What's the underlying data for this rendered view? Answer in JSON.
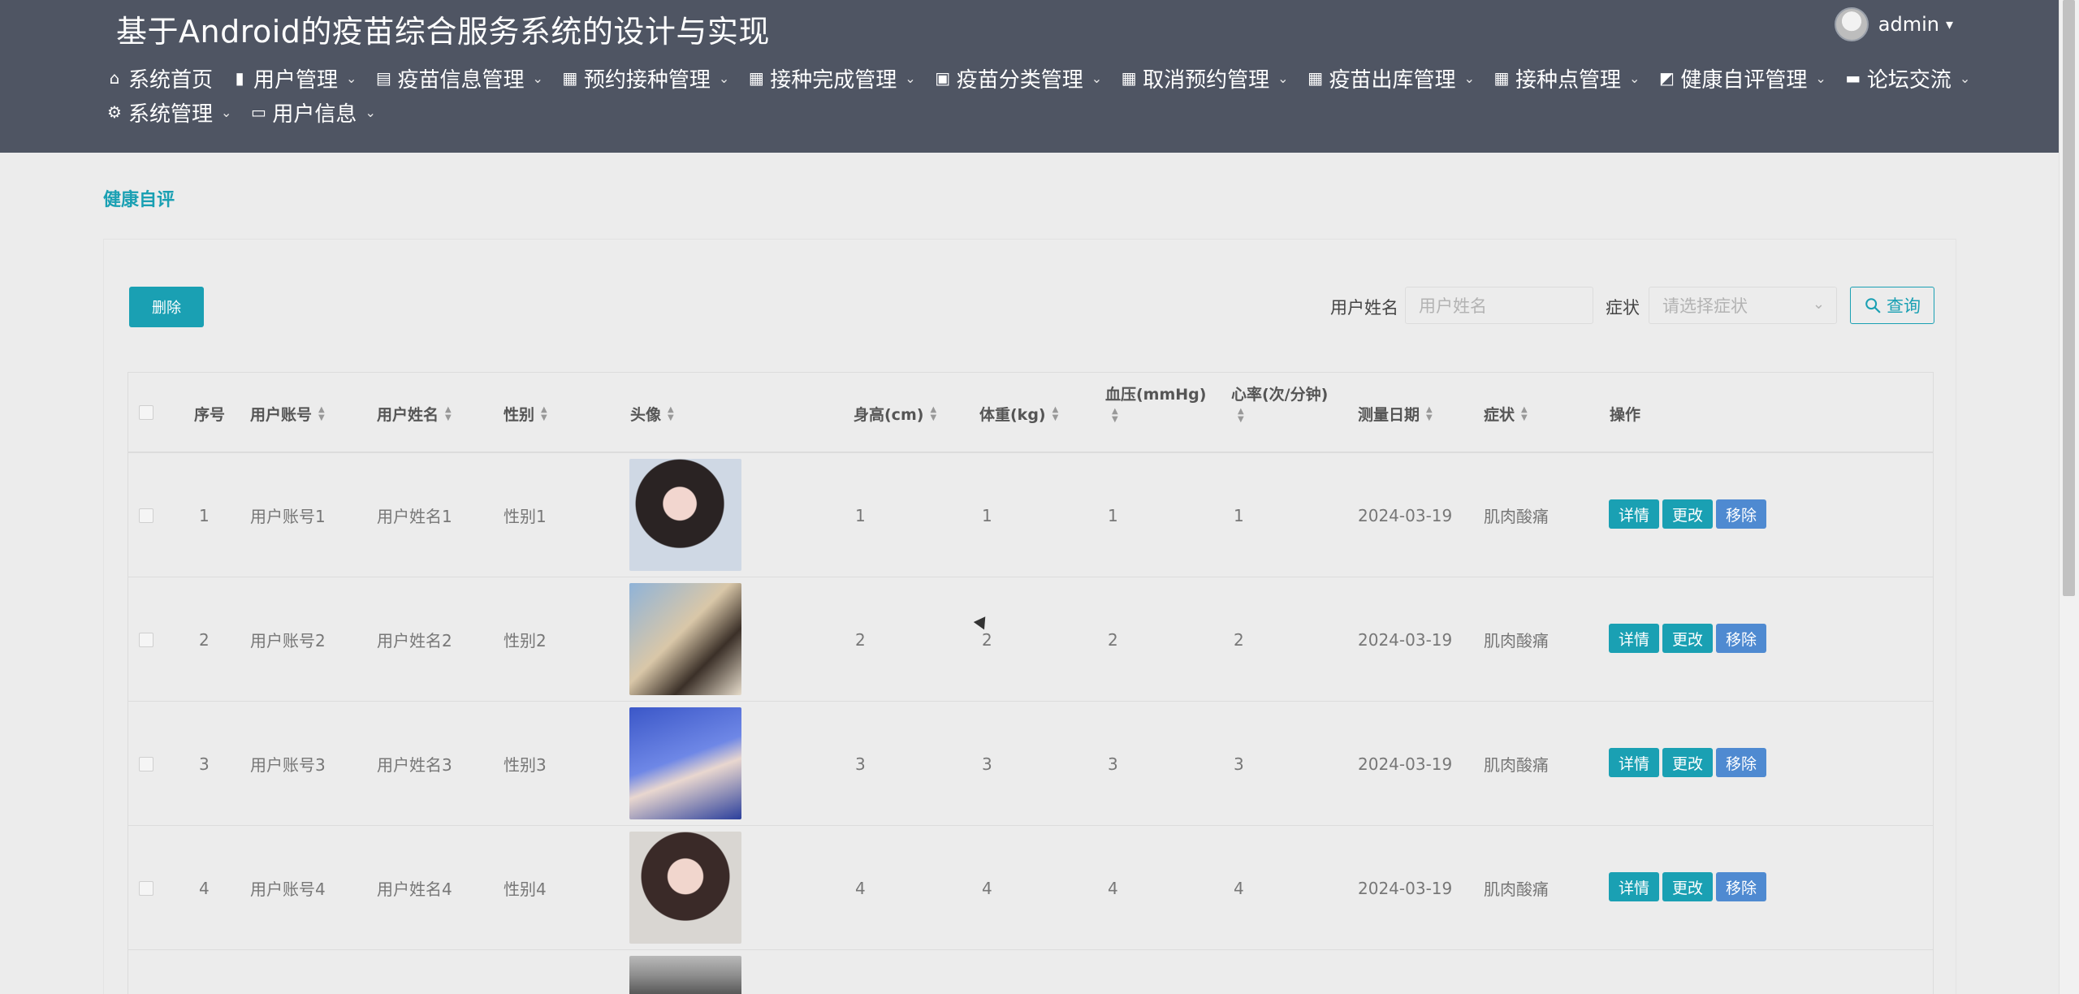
{
  "app": {
    "title": "基于Android的疫苗综合服务系统的设计与实现"
  },
  "user": {
    "name": "admin",
    "avatar_icon": "user-avatar-icon"
  },
  "nav": [
    {
      "label": "系统首页",
      "icon": "home-icon",
      "dropdown": false
    },
    {
      "label": "用户管理",
      "icon": "bar-chart-icon",
      "dropdown": true
    },
    {
      "label": "疫苗信息管理",
      "icon": "clipboard-icon",
      "dropdown": true
    },
    {
      "label": "预约接种管理",
      "icon": "grid-icon",
      "dropdown": true
    },
    {
      "label": "接种完成管理",
      "icon": "grid-icon",
      "dropdown": true
    },
    {
      "label": "疫苗分类管理",
      "icon": "clipboard-check-icon",
      "dropdown": true
    },
    {
      "label": "取消预约管理",
      "icon": "grid-icon",
      "dropdown": true
    },
    {
      "label": "疫苗出库管理",
      "icon": "grid-icon",
      "dropdown": true
    },
    {
      "label": "接种点管理",
      "icon": "grid-icon",
      "dropdown": true
    },
    {
      "label": "健康自评管理",
      "icon": "line-chart-icon",
      "dropdown": true
    },
    {
      "label": "论坛交流",
      "icon": "forum-icon",
      "dropdown": true
    },
    {
      "label": "系统管理",
      "icon": "settings-icon",
      "dropdown": true
    },
    {
      "label": "用户信息",
      "icon": "id-card-icon",
      "dropdown": true
    }
  ],
  "breadcrumb": "健康自评",
  "toolbar": {
    "delete_label": "删除"
  },
  "search": {
    "name_label": "用户姓名",
    "name_placeholder": "用户姓名",
    "symptom_label": "症状",
    "symptom_placeholder": "请选择症状",
    "query_label": "查询"
  },
  "table": {
    "headers": {
      "index": "序号",
      "account": "用户账号",
      "name": "用户姓名",
      "gender": "性别",
      "avatar": "头像",
      "height": "身高(cm)",
      "weight": "体重(kg)",
      "bp": "血压(mmHg)",
      "hr": "心率(次/分钟)",
      "date": "测量日期",
      "symptom": "症状",
      "ops": "操作"
    },
    "rows": [
      {
        "index": "1",
        "account": "用户账号1",
        "name": "用户姓名1",
        "gender": "性别1",
        "height": "1",
        "weight": "1",
        "bp": "1",
        "hr": "1",
        "date": "2024-03-19",
        "symptom": "肌肉酸痛"
      },
      {
        "index": "2",
        "account": "用户账号2",
        "name": "用户姓名2",
        "gender": "性别2",
        "height": "2",
        "weight": "2",
        "bp": "2",
        "hr": "2",
        "date": "2024-03-19",
        "symptom": "肌肉酸痛"
      },
      {
        "index": "3",
        "account": "用户账号3",
        "name": "用户姓名3",
        "gender": "性别3",
        "height": "3",
        "weight": "3",
        "bp": "3",
        "hr": "3",
        "date": "2024-03-19",
        "symptom": "肌肉酸痛"
      },
      {
        "index": "4",
        "account": "用户账号4",
        "name": "用户姓名4",
        "gender": "性别4",
        "height": "4",
        "weight": "4",
        "bp": "4",
        "hr": "4",
        "date": "2024-03-19",
        "symptom": "肌肉酸痛"
      }
    ],
    "actions": {
      "detail": "详情",
      "edit": "更改",
      "remove": "移除"
    }
  },
  "colors": {
    "header_bg": "#4f5563",
    "accent": "#1aa0b3",
    "remove_btn": "#4f8ad1",
    "page_bg": "#ececec"
  }
}
